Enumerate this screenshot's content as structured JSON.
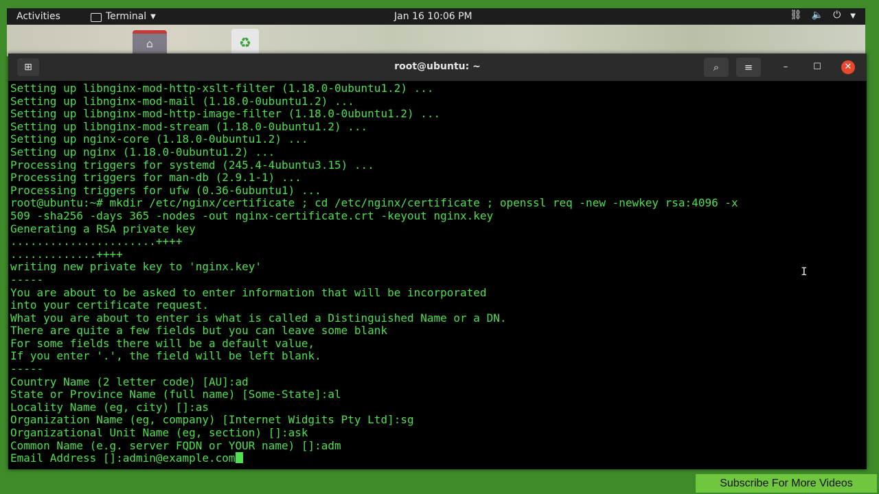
{
  "topbar": {
    "activities": "Activities",
    "app_name": "Terminal",
    "clock": "Jan 16  10:06 PM",
    "icons": [
      "network-icon",
      "volume-icon",
      "power-icon",
      "chevron-down-icon"
    ]
  },
  "desktop": {
    "icons": [
      "home-folder-icon",
      "trash-icon"
    ]
  },
  "window": {
    "title": "root@ubuntu: ~",
    "buttons": [
      "new-tab-icon",
      "search-icon",
      "hamburger-menu-icon",
      "minimize-icon",
      "maximize-icon",
      "close-icon"
    ]
  },
  "terminal": {
    "lines": [
      "Setting up libnginx-mod-http-xslt-filter (1.18.0-0ubuntu1.2) ...",
      "Setting up libnginx-mod-mail (1.18.0-0ubuntu1.2) ...",
      "Setting up libnginx-mod-http-image-filter (1.18.0-0ubuntu1.2) ...",
      "Setting up libnginx-mod-stream (1.18.0-0ubuntu1.2) ...",
      "Setting up nginx-core (1.18.0-0ubuntu1.2) ...",
      "Setting up nginx (1.18.0-0ubuntu1.2) ...",
      "Processing triggers for systemd (245.4-4ubuntu3.15) ...",
      "Processing triggers for man-db (2.9.1-1) ...",
      "Processing triggers for ufw (0.36-6ubuntu1) ...",
      "root@ubuntu:~# mkdir /etc/nginx/certificate ; cd /etc/nginx/certificate ; openssl req -new -newkey rsa:4096 -x",
      "509 -sha256 -days 365 -nodes -out nginx-certificate.crt -keyout nginx.key",
      "Generating a RSA private key",
      "......................++++",
      ".............++++",
      "writing new private key to 'nginx.key'",
      "-----",
      "You are about to be asked to enter information that will be incorporated",
      "into your certificate request.",
      "What you are about to enter is what is called a Distinguished Name or a DN.",
      "There are quite a few fields but you can leave some blank",
      "For some fields there will be a default value,",
      "If you enter '.', the field will be left blank.",
      "-----",
      "Country Name (2 letter code) [AU]:ad",
      "State or Province Name (full name) [Some-State]:al",
      "Locality Name (eg, city) []:as",
      "Organization Name (eg, company) [Internet Widgits Pty Ltd]:sg",
      "Organizational Unit Name (eg, section) []:ask",
      "Common Name (e.g. server FQDN or YOUR name) []:adm",
      "Email Address []:admin@example.com"
    ]
  },
  "overlay": {
    "subscribe": "Subscribe For More Videos"
  },
  "colors": {
    "terminal_text": "#4fe04f",
    "terminal_bg": "#000000",
    "frame": "#3f8b2a",
    "close_button": "#e8492d",
    "subscribe_bg": "#71c63f"
  }
}
